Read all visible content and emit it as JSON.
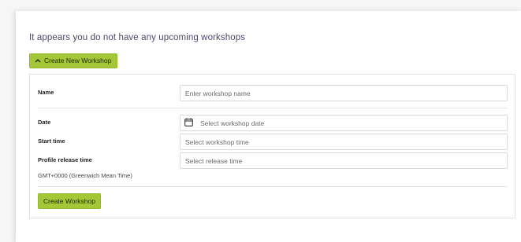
{
  "notice": "It appears you do not have any upcoming workshops",
  "toggle_button": {
    "label": "Create New Workshop",
    "icon": "chevron-up-icon"
  },
  "form": {
    "name": {
      "label": "Name",
      "placeholder": "Enter workshop name"
    },
    "date": {
      "label": "Date",
      "placeholder": "Select workshop date",
      "icon": "calendar-icon"
    },
    "start_time": {
      "label": "Start time",
      "placeholder": "Select workshop time"
    },
    "profile_release_time": {
      "label": "Profile release time",
      "placeholder": "Select release time"
    },
    "timezone": "GMT+0000 (Greenwich Mean Time)",
    "submit_label": "Create Workshop"
  },
  "colors": {
    "accent": "#a3c737",
    "accent_border": "#94b72c",
    "text_muted": "#6b6b6b"
  }
}
